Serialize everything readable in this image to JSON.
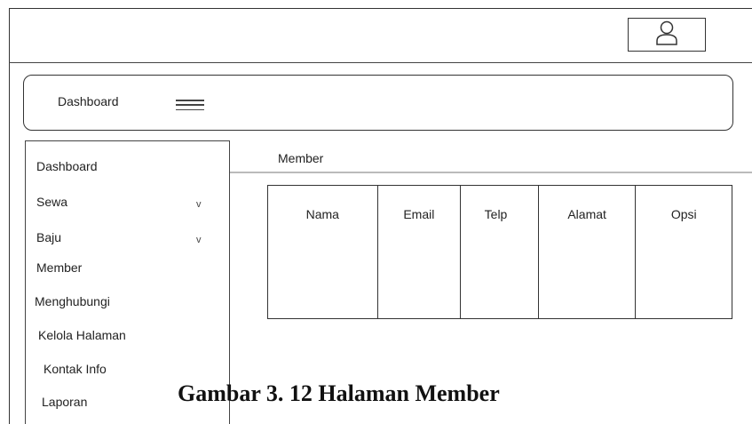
{
  "header": {
    "user_icon": "user-icon"
  },
  "navbar": {
    "title": "Dashboard",
    "menu_icon": "hamburger-icon"
  },
  "sidebar": {
    "items": [
      {
        "label": "Dashboard",
        "has_chevron": false
      },
      {
        "label": "Sewa",
        "has_chevron": true,
        "chevron": "v"
      },
      {
        "label": "Baju",
        "has_chevron": true,
        "chevron": "v"
      },
      {
        "label": "Member",
        "has_chevron": false
      },
      {
        "label": "Menghubungi",
        "has_chevron": false
      },
      {
        "label": "Kelola Halaman",
        "has_chevron": false
      },
      {
        "label": "Kontak Info",
        "has_chevron": false
      },
      {
        "label": "Laporan",
        "has_chevron": false
      }
    ]
  },
  "main": {
    "page_title": "Member",
    "table": {
      "columns": [
        "Nama",
        "Email",
        "Telp",
        "Alamat",
        "Opsi"
      ]
    }
  },
  "caption": "Gambar 3. 12 Halaman Member"
}
